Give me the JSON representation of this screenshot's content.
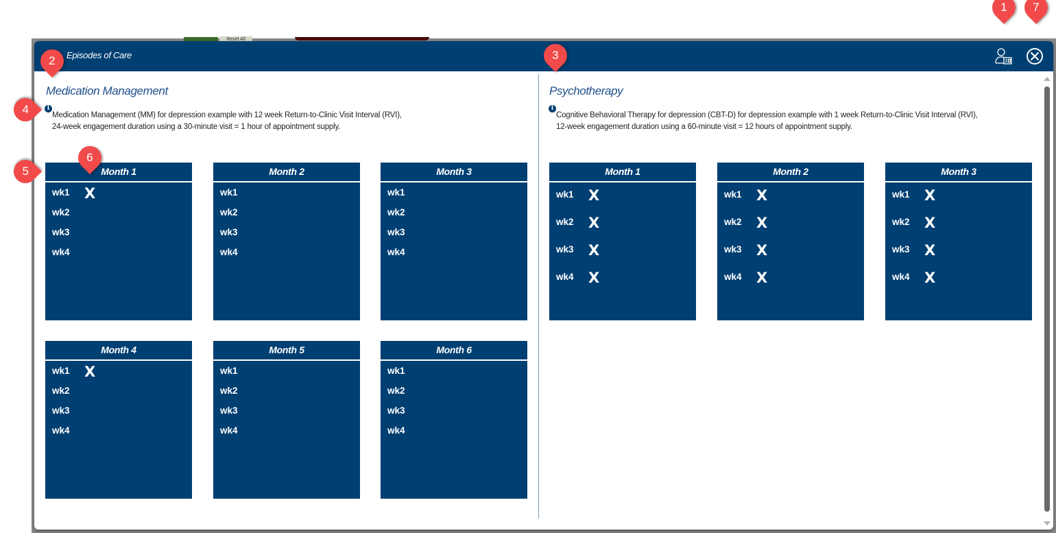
{
  "background": {
    "reset_label": "Reset All"
  },
  "modal": {
    "title": "Episodes of Care",
    "header_icons": [
      "provider-profile-icon",
      "close-circle-icon"
    ]
  },
  "medication": {
    "title": "Medication Management",
    "desc_line1": "Medication Management (MM) for depression example with 12 week Return-to-Clinic Visit Interval (RVI),",
    "desc_line2": "24-week engagement duration using a 30-minute visit = 1 hour of appointment supply.",
    "months": [
      {
        "label": "Month 1",
        "weeks": [
          {
            "label": "wk1",
            "mark": "X"
          },
          {
            "label": "wk2",
            "mark": ""
          },
          {
            "label": "wk3",
            "mark": ""
          },
          {
            "label": "wk4",
            "mark": ""
          }
        ]
      },
      {
        "label": "Month 2",
        "weeks": [
          {
            "label": "wk1",
            "mark": ""
          },
          {
            "label": "wk2",
            "mark": ""
          },
          {
            "label": "wk3",
            "mark": ""
          },
          {
            "label": "wk4",
            "mark": ""
          }
        ]
      },
      {
        "label": "Month 3",
        "weeks": [
          {
            "label": "wk1",
            "mark": ""
          },
          {
            "label": "wk2",
            "mark": ""
          },
          {
            "label": "wk3",
            "mark": ""
          },
          {
            "label": "wk4",
            "mark": ""
          }
        ]
      },
      {
        "label": "Month 4",
        "weeks": [
          {
            "label": "wk1",
            "mark": "X"
          },
          {
            "label": "wk2",
            "mark": ""
          },
          {
            "label": "wk3",
            "mark": ""
          },
          {
            "label": "wk4",
            "mark": ""
          }
        ]
      },
      {
        "label": "Month 5",
        "weeks": [
          {
            "label": "wk1",
            "mark": ""
          },
          {
            "label": "wk2",
            "mark": ""
          },
          {
            "label": "wk3",
            "mark": ""
          },
          {
            "label": "wk4",
            "mark": ""
          }
        ]
      },
      {
        "label": "Month 6",
        "weeks": [
          {
            "label": "wk1",
            "mark": ""
          },
          {
            "label": "wk2",
            "mark": ""
          },
          {
            "label": "wk3",
            "mark": ""
          },
          {
            "label": "wk4",
            "mark": ""
          }
        ]
      }
    ]
  },
  "psychotherapy": {
    "title": "Psychotherapy",
    "desc_line1": "Cognitive Behavioral Therapy for depression (CBT-D) for depression example with 1 week Return-to-Clinic Visit Interval (RVI),",
    "desc_line2": "12-week engagement duration using a 60-minute visit = 12 hours of appointment supply.",
    "months": [
      {
        "label": "Month 1",
        "weeks": [
          {
            "label": "wk1",
            "mark": "X"
          },
          {
            "label": "wk2",
            "mark": "X"
          },
          {
            "label": "wk3",
            "mark": "X"
          },
          {
            "label": "wk4",
            "mark": "X"
          }
        ]
      },
      {
        "label": "Month 2",
        "weeks": [
          {
            "label": "wk1",
            "mark": "X"
          },
          {
            "label": "wk2",
            "mark": "X"
          },
          {
            "label": "wk3",
            "mark": "X"
          },
          {
            "label": "wk4",
            "mark": "X"
          }
        ]
      },
      {
        "label": "Month 3",
        "weeks": [
          {
            "label": "wk1",
            "mark": "X"
          },
          {
            "label": "wk2",
            "mark": "X"
          },
          {
            "label": "wk3",
            "mark": "X"
          },
          {
            "label": "wk4",
            "mark": "X"
          }
        ]
      }
    ]
  },
  "annotations": [
    "1",
    "2",
    "3",
    "4",
    "5",
    "6",
    "7"
  ],
  "colors": {
    "header": "#003f72",
    "annotation": "#f24a4a",
    "section_title": "#1f4e8c"
  }
}
